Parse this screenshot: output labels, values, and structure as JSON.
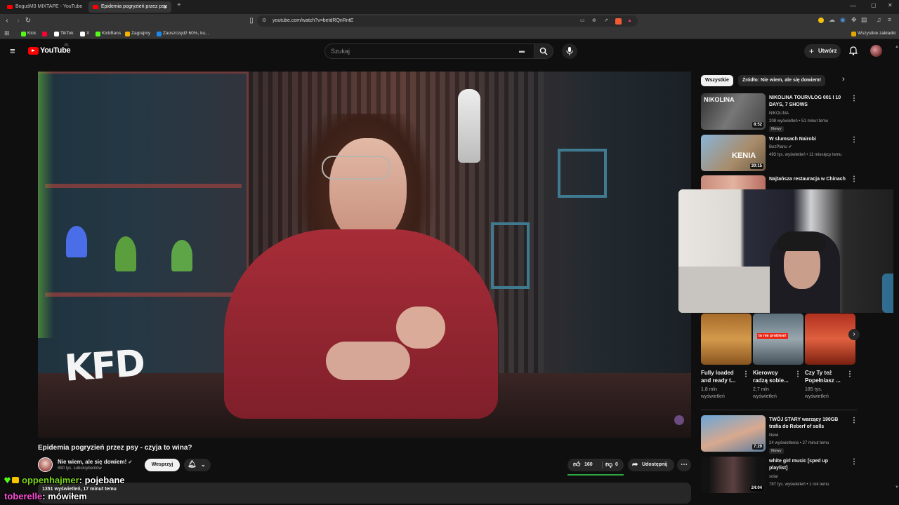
{
  "browser": {
    "tabs": [
      {
        "title": "BoguśM3 MIXTAPE - YouTube",
        "active": false
      },
      {
        "title": "Epidemia pogryzień przez psy",
        "active": true
      }
    ],
    "url": "youtube.com/watch?v=betdRQnRntE",
    "bookmarks": [
      {
        "label": "Kick",
        "color": "#53fc18"
      },
      {
        "label": "",
        "color": "#ff0033"
      },
      {
        "label": "TikTok",
        "color": "#ffffff"
      },
      {
        "label": "X",
        "color": "#ffffff"
      },
      {
        "label": "KickBans",
        "color": "#53fc18"
      },
      {
        "label": "Zagrajmy",
        "color": "#f5b400"
      },
      {
        "label": "Zaoszczędź 60%, ku...",
        "color": "#1e88e5"
      }
    ],
    "all_bookmarks": "Wszystkie zakładki"
  },
  "youtube": {
    "logo": "YouTube",
    "region": "PL",
    "search_placeholder": "Szukaj",
    "create_label": "Utwórz"
  },
  "video": {
    "overlay_logo": "KFD",
    "title": "Epidemia pogryzień przez psy - czyja to wina?",
    "channel": "Nie wiem, ale się dowiem!",
    "subscribers": "890 tys. subskrybentów",
    "subscribe_label": "Wesprzyj",
    "likes": "160",
    "dislikes": "0",
    "share_label": "Udostępnij",
    "views_partial": "1351 wyświetleń, 17 minut temu"
  },
  "sidebar": {
    "chips": [
      "Wszystkie",
      "Źródło: Nie wiem, ale się dowiem!"
    ],
    "items": [
      {
        "title": "NIKOLINA TOURVLOG 001 I 10 DAYS, 7 SHOWS",
        "channel": "NIKOLINA",
        "meta": "208 wyświetleń • 51 minut temu",
        "badge": "Nowy",
        "duration": "8:52",
        "thumb_text": "NIKOLINA"
      },
      {
        "title": "W slumsach Nairobi",
        "channel": "BezPlanu",
        "meta": "493 tys. wyświetleń • 11 miesięcy temu",
        "badge": "",
        "duration": "30:15",
        "thumb_text": "KENIA"
      },
      {
        "title": "Najtańsza restauracja w Chinach",
        "channel": "",
        "meta": "",
        "badge": "",
        "duration": "",
        "thumb_text": ""
      }
    ],
    "shorts": [
      {
        "title": "Fully loaded and ready t...",
        "views": "1,8 mln wyświetleń"
      },
      {
        "title": "Kierowcy radzą sobie...",
        "views": "2,7 mln wyświetleń",
        "thumb_text": "to nie problem!"
      },
      {
        "title": "Czy Ty też Popełniasz ...",
        "views": "185 tys. wyświetleń"
      }
    ],
    "items2": [
      {
        "title": "TWÓJ STARY warzący 190GB trafia do Reberf of solls",
        "channel": "Newi",
        "meta": "24 wyświetlenia • 27 minut temu",
        "badge": "Nowy",
        "duration": "7:29"
      },
      {
        "title": "white girl music [sped up playlist]",
        "channel": "solar",
        "meta": "787 tys. wyświetleń • 1 rok temu",
        "badge": "",
        "duration": "24:04"
      }
    ]
  },
  "chat": [
    {
      "user": "oppenhajmer",
      "message": ": pojebane",
      "color": "#7cd61f"
    },
    {
      "user": "toberelle",
      "message": ": mówiłem",
      "color": "#ff4fd8"
    }
  ]
}
